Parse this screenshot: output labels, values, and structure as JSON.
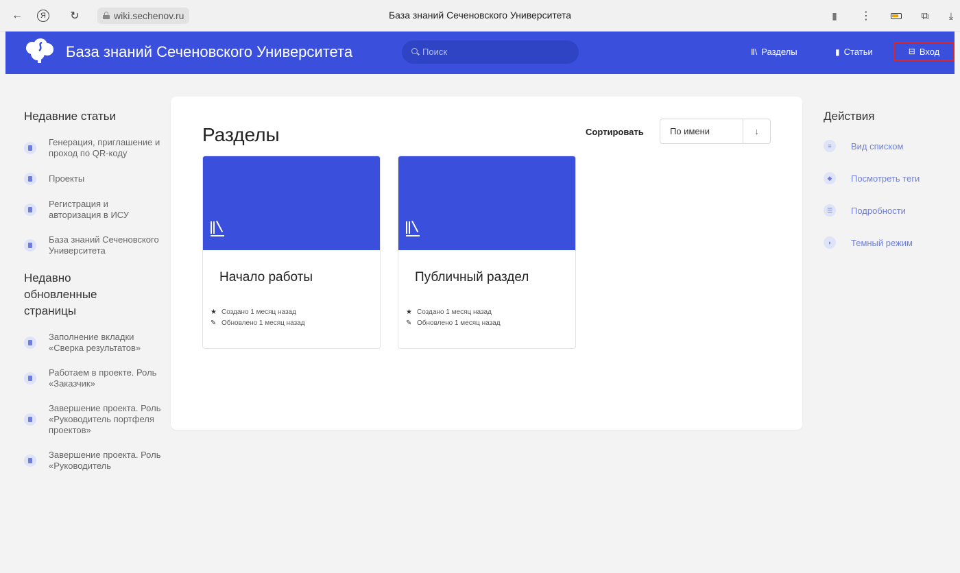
{
  "browser": {
    "url": "wiki.sechenov.ru",
    "tab_title": "База знаний Сеченовского Университета"
  },
  "header": {
    "site_title": "База знаний Сеченовского Университета",
    "search_placeholder": "Поиск",
    "nav": {
      "sections": "Разделы",
      "articles": "Статьи",
      "login": "Вход"
    },
    "brand_color": "#3a50dc",
    "login_highlight_color": "#d9262b"
  },
  "sidebar_left": {
    "recent_articles_title": "Недавние статьи",
    "recent_articles": [
      "Генерация, приглашение и проход по QR-коду",
      "Проекты",
      "Регистрация и авторизация в ИСУ",
      "База знаний Сеченовского Университета"
    ],
    "recent_pages_title": "Недавно обновленные страницы",
    "recent_pages": [
      "Заполнение вкладки «Сверка результатов»",
      "Работаем в проекте. Роль «Заказчик»",
      "Завершение проекта. Роль «Руководитель портфеля проектов»",
      "Завершение проекта. Роль «Руководитель"
    ]
  },
  "main": {
    "title": "Разделы",
    "sort_label": "Сортировать",
    "sort_value": "По имени",
    "sort_direction": "↓",
    "sections": [
      {
        "name": "Начало работы",
        "created": "Создано 1 месяц назад",
        "updated": "Обновлено 1 месяц назад"
      },
      {
        "name": "Публичный раздел",
        "created": "Создано 1 месяц назад",
        "updated": "Обновлено 1 месяц назад"
      }
    ]
  },
  "sidebar_right": {
    "title": "Действия",
    "actions": [
      {
        "label": "Вид списком",
        "icon": "list-icon"
      },
      {
        "label": "Посмотреть теги",
        "icon": "tag-icon"
      },
      {
        "label": "Подробности",
        "icon": "details-icon"
      },
      {
        "label": "Темный режим",
        "icon": "moon-icon"
      }
    ]
  }
}
